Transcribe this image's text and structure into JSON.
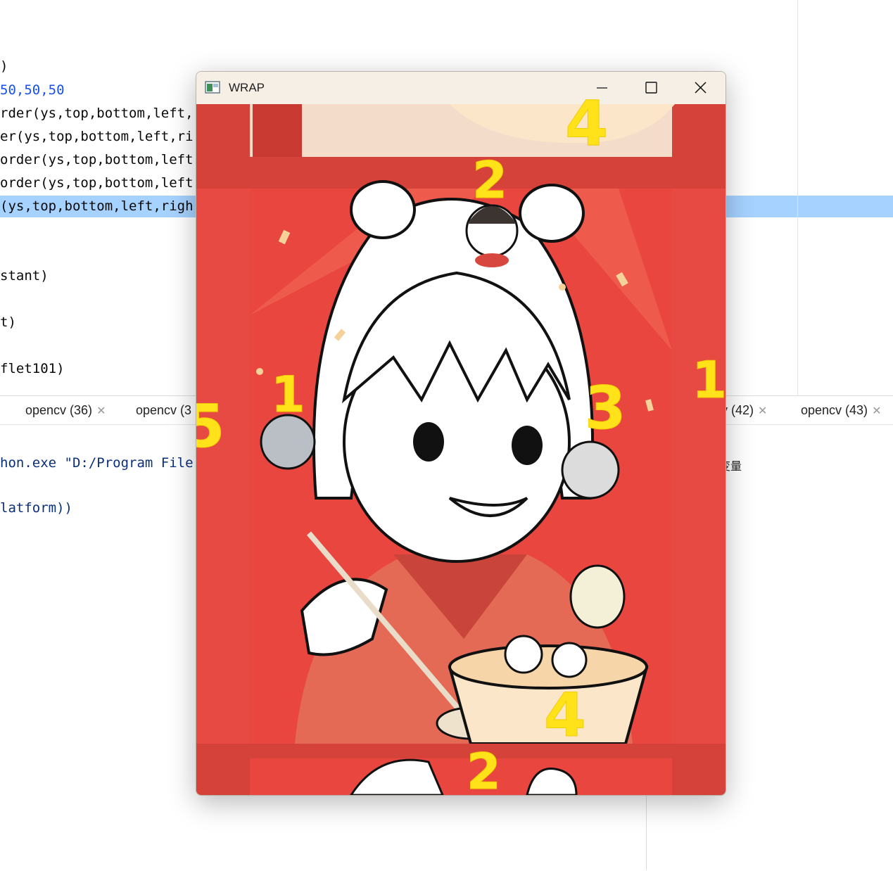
{
  "editor": {
    "lines": [
      {
        "text": ")",
        "style": "plain"
      },
      {
        "text": "50,50,50",
        "style": "blue"
      },
      {
        "text": "rder(ys,top,bottom,left,",
        "style": "plain"
      },
      {
        "text": "er(ys,top,bottom,left,ri",
        "style": "plain"
      },
      {
        "text": "order(ys,top,bottom,left",
        "style": "plain"
      },
      {
        "text": "order(ys,top,bottom,left",
        "style": "plain"
      },
      {
        "text": "(ys,top,bottom,left,righ",
        "style": "selected"
      },
      {
        "text": "stant)",
        "style": "plain"
      },
      {
        "text": "t)",
        "style": "plain"
      },
      {
        "text": "flet101)",
        "style": "plain"
      }
    ]
  },
  "run_panel": {
    "tabs": [
      {
        "label": "opencv (36)"
      },
      {
        "label": "opencv (3"
      },
      {
        "label": "v (42)"
      },
      {
        "label": "opencv (43)"
      }
    ],
    "console_lines": [
      "hon.exe \"D:/Program File",
      "latform))"
    ],
    "side_text": "变量"
  },
  "window": {
    "title": "WRAP",
    "controls": {
      "minimize": "minimize-icon",
      "maximize": "maximize-icon",
      "close": "close-icon"
    }
  },
  "annotations": [
    "4",
    "2",
    "1",
    "3",
    "5",
    "1",
    "4",
    "2"
  ],
  "colors": {
    "selection": "#a6d2ff",
    "code_blue": "#1750eb",
    "annotation_yellow": "#ffe21a",
    "image_red": "#e8463f",
    "image_border_red": "#d4423a"
  }
}
